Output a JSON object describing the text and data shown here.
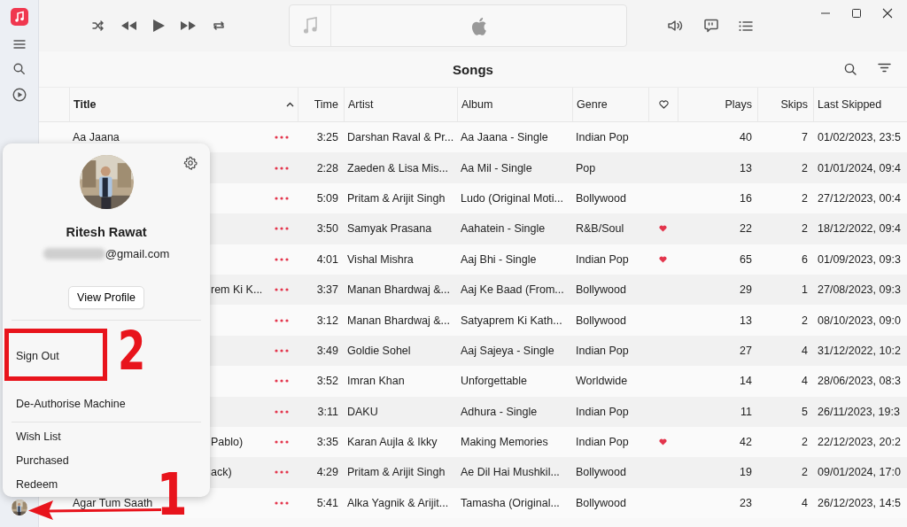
{
  "page": {
    "title": "Songs"
  },
  "table": {
    "columns": [
      {
        "kind": "text",
        "label": "Title",
        "sorted": true
      },
      {
        "kind": "text",
        "label": "Time",
        "sorted": false
      },
      {
        "kind": "text",
        "label": "Artist",
        "sorted": false
      },
      {
        "kind": "text",
        "label": "Album",
        "sorted": false
      },
      {
        "kind": "text",
        "label": "Genre",
        "sorted": false
      },
      {
        "kind": "icon",
        "sorted": false
      },
      {
        "kind": "text",
        "label": "Plays",
        "sorted": false
      },
      {
        "kind": "text",
        "label": "Skips",
        "sorted": false
      },
      {
        "kind": "text",
        "label": "Last Skipped",
        "sorted": false
      }
    ],
    "rows": [
      {
        "title": "Aa Jaana",
        "time": "3:25",
        "artist": "Darshan Raval & Pr...",
        "album": "Aa Jaana - Single",
        "genre": "Indian Pop",
        "loved": false,
        "plays": "40",
        "skips": "7",
        "last_skipped": "01/02/2023, 23:5"
      },
      {
        "time": "2:28",
        "artist": "Zaeden & Lisa Mis...",
        "album": "Aa Mil - Single",
        "genre": "Pop",
        "loved": false,
        "plays": "13",
        "skips": "2",
        "last_skipped": "01/01/2024, 09:4"
      },
      {
        "time": "5:09",
        "artist": "Pritam & Arijit Singh",
        "album": "Ludo (Original Moti...",
        "genre": "Bollywood",
        "loved": false,
        "plays": "16",
        "skips": "2",
        "last_skipped": "27/12/2023, 00:4"
      },
      {
        "time": "3:50",
        "artist": "Samyak Prasana",
        "album": "Aahatein - Single",
        "genre": "R&B/Soul",
        "loved": true,
        "plays": "22",
        "skips": "2",
        "last_skipped": "18/12/2022, 09:4"
      },
      {
        "time": "4:01",
        "artist": "Vishal Mishra",
        "album": "Aaj Bhi - Single",
        "genre": "Indian Pop",
        "loved": true,
        "plays": "65",
        "skips": "6",
        "last_skipped": "01/09/2023, 09:3"
      },
      {
        "title_tail": "rem Ki K...",
        "time": "3:37",
        "artist": "Manan Bhardwaj &...",
        "album": "Aaj Ke Baad (From...",
        "genre": "Bollywood",
        "loved": false,
        "plays": "29",
        "skips": "1",
        "last_skipped": "27/08/2023, 09:3"
      },
      {
        "time": "3:12",
        "artist": "Manan Bhardwaj &...",
        "album": "Satyaprem Ki Kath...",
        "genre": "Bollywood",
        "loved": false,
        "plays": "13",
        "skips": "2",
        "last_skipped": "08/10/2023, 09:0"
      },
      {
        "time": "3:49",
        "artist": "Goldie Sohel",
        "album": "Aaj Sajeya - Single",
        "genre": "Indian Pop",
        "loved": false,
        "plays": "27",
        "skips": "4",
        "last_skipped": "31/12/2022, 10:2"
      },
      {
        "time": "3:52",
        "artist": "Imran Khan",
        "album": "Unforgettable",
        "genre": "Worldwide",
        "loved": false,
        "plays": "14",
        "skips": "4",
        "last_skipped": "28/06/2023, 08:3"
      },
      {
        "time": "3:11",
        "artist": "DAKU",
        "album": "Adhura - Single",
        "genre": "Indian Pop",
        "loved": false,
        "plays": "11",
        "skips": "5",
        "last_skipped": "26/11/2023, 19:3"
      },
      {
        "title_tail": "Pablo)",
        "time": "3:35",
        "artist": "Karan Aujla & Ikky",
        "album": "Making Memories",
        "genre": "Indian Pop",
        "loved": true,
        "plays": "42",
        "skips": "2",
        "last_skipped": "22/12/2023, 20:2"
      },
      {
        "title_tail": "ack)",
        "time": "4:29",
        "artist": "Pritam & Arijit Singh",
        "album": "Ae Dil Hai Mushkil...",
        "genre": "Bollywood",
        "loved": false,
        "plays": "19",
        "skips": "2",
        "last_skipped": "09/01/2024, 17:0"
      },
      {
        "title": "Agar Tum Saath",
        "time": "5:41",
        "artist": "Alka Yagnik & Arijit...",
        "album": "Tamasha (Original...",
        "genre": "Bollywood",
        "loved": false,
        "plays": "23",
        "skips": "4",
        "last_skipped": "26/12/2023, 14:5"
      }
    ]
  },
  "account_menu": {
    "name": "Ritesh Rawat",
    "email": "@gmail.com",
    "button": "View Profile",
    "groups": [
      [
        "Sign Out",
        "De-Authorise Machine"
      ],
      [
        "Wish List",
        "Purchased",
        "Redeem"
      ]
    ]
  },
  "annotations": [
    {
      "kind": "box"
    },
    {
      "kind": "number",
      "text": "2"
    },
    {
      "kind": "number",
      "text": "1"
    },
    {
      "kind": "arrow"
    }
  ]
}
